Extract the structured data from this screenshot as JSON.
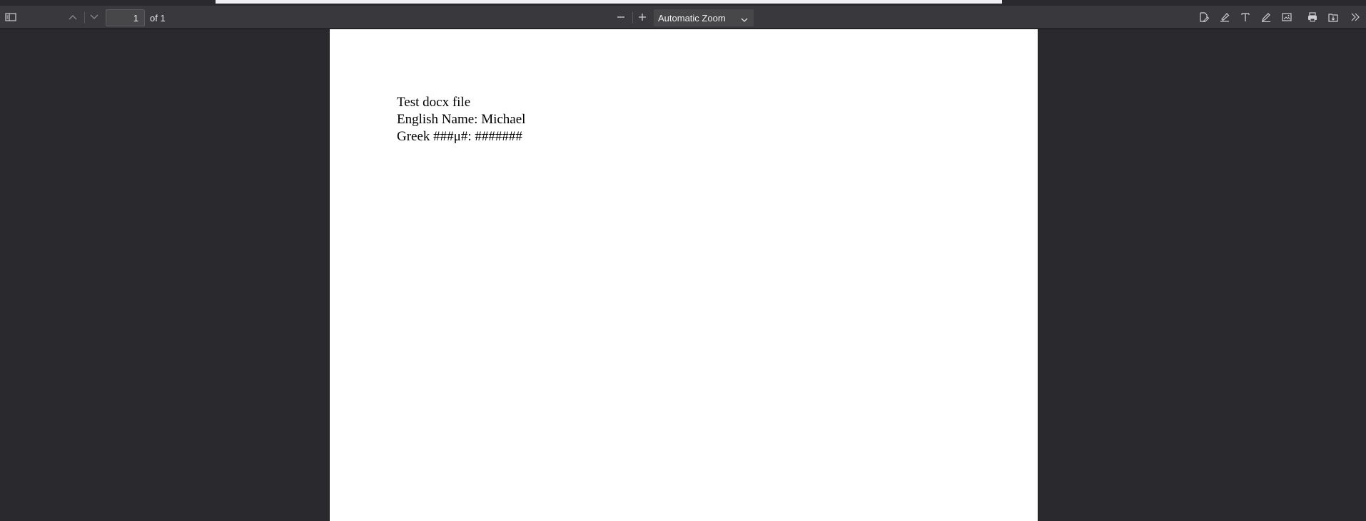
{
  "toolbar": {
    "page_number": "1",
    "page_count_label": "of 1",
    "zoom_label": "Automatic Zoom",
    "icons": {
      "sidebar": "sidebar-toggle-icon",
      "prev": "chevron-up-icon",
      "next": "chevron-down-icon",
      "zoom_out": "minus-icon",
      "zoom_in": "plus-icon",
      "zoom_dropdown": "chevron-down-icon",
      "editor_signature": "signature-icon",
      "editor_highlight": "highlight-icon",
      "editor_text": "text-icon",
      "editor_draw": "draw-pen-icon",
      "editor_image": "image-icon",
      "print": "print-icon",
      "save": "download-icon",
      "tools": "double-chevron-right-icon"
    }
  },
  "document": {
    "lines": [
      "Test docx file",
      "English Name: Michael",
      "Greek ###μ#: #######"
    ]
  },
  "colors": {
    "toolbar_bg": "#38383d",
    "viewer_bg": "#2a2a2e",
    "page_bg": "#ffffff",
    "icon": "#cfcfd2"
  }
}
